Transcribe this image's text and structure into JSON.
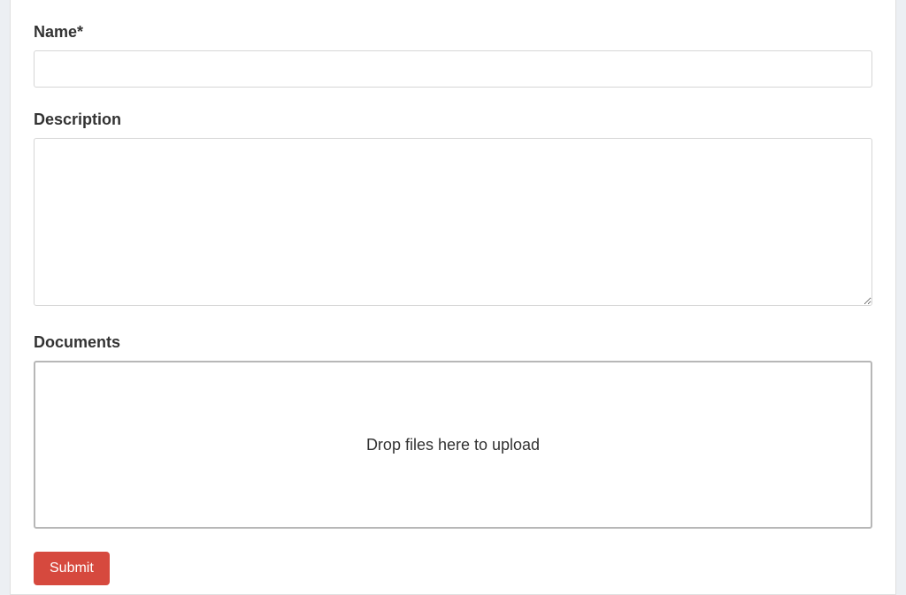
{
  "form": {
    "name": {
      "label": "Name*",
      "value": ""
    },
    "description": {
      "label": "Description",
      "value": ""
    },
    "documents": {
      "label": "Documents",
      "dropzone_text": "Drop files here to upload"
    },
    "submit_label": "Submit"
  }
}
